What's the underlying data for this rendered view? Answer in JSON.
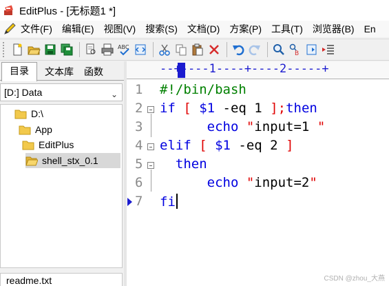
{
  "window": {
    "title": "EditPlus - [无标题1 *]"
  },
  "menu": {
    "items": [
      "文件(F)",
      "编辑(E)",
      "视图(V)",
      "搜索(S)",
      "文档(D)",
      "方案(P)",
      "工具(T)",
      "浏览器(B)",
      "En"
    ]
  },
  "toolbar": {
    "icons": [
      "new-file-icon",
      "open-folder-icon",
      "save-icon",
      "save-all-icon",
      "print-preview-icon",
      "print-icon",
      "spell-check-icon",
      "browser-icon",
      "cut-icon",
      "copy-icon",
      "paste-icon",
      "delete-icon",
      "undo-icon",
      "redo-icon",
      "find-icon",
      "replace-icon",
      "function-list-icon",
      "indent-icon"
    ]
  },
  "sidebar": {
    "tabs": [
      "目录",
      "文本库",
      "函数"
    ],
    "drive": "[D:] Data",
    "tree": [
      "D:\\",
      "App",
      "EditPlus",
      "shell_stx_0.1"
    ],
    "selected": "shell_stx_0.1",
    "file": "readme.txt"
  },
  "ruler": {
    "text": "--+----1----+----2-----+"
  },
  "editor": {
    "line_numbers": [
      "1",
      "2",
      "3",
      "4",
      "5",
      "6",
      "7"
    ],
    "lines": [
      [
        {
          "t": "#!/bin/bash",
          "c": "cmt"
        }
      ],
      [
        {
          "t": "if ",
          "c": "kw"
        },
        {
          "t": "[ ",
          "c": "br"
        },
        {
          "t": "$1 ",
          "c": "var"
        },
        {
          "t": "-eq 1 ",
          "c": "plain"
        },
        {
          "t": "];",
          "c": "br"
        },
        {
          "t": "then",
          "c": "kw"
        }
      ],
      [
        {
          "t": "      ",
          "c": "plain"
        },
        {
          "t": "echo ",
          "c": "kw"
        },
        {
          "t": "\"",
          "c": "br"
        },
        {
          "t": "input=1 ",
          "c": "plain"
        },
        {
          "t": "\"",
          "c": "br"
        }
      ],
      [
        {
          "t": "elif ",
          "c": "kw"
        },
        {
          "t": "[ ",
          "c": "br"
        },
        {
          "t": "$1 ",
          "c": "var"
        },
        {
          "t": "-eq 2 ",
          "c": "plain"
        },
        {
          "t": "]",
          "c": "br"
        }
      ],
      [
        {
          "t": "  then",
          "c": "kw"
        }
      ],
      [
        {
          "t": "      ",
          "c": "plain"
        },
        {
          "t": "echo ",
          "c": "kw"
        },
        {
          "t": "\"",
          "c": "br"
        },
        {
          "t": "input=2",
          "c": "plain"
        },
        {
          "t": "\"",
          "c": "br"
        }
      ],
      [
        {
          "t": "fi",
          "c": "kw"
        }
      ]
    ]
  },
  "watermark": "CSDN @zhou_大燕"
}
